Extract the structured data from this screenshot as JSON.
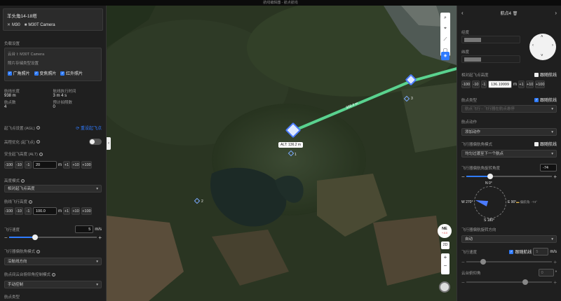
{
  "window_title": "航线编辑器 - 航点航线",
  "left": {
    "mission_name": "羊头角14-18塔",
    "drone": "M30",
    "camera": "M30T Camera",
    "payload_section": "负载设置",
    "payload_name": "云台 I: M30T Camera",
    "photo_storage_label": "照片存储类型设置",
    "photo_types": [
      "广角照片",
      "变焦照片",
      "红外照片"
    ],
    "stats": [
      {
        "label": "航线长度",
        "value": "938 m"
      },
      {
        "label": "航线执行时间",
        "value": "3 m 4 s"
      },
      {
        "label": "航点数",
        "value": "4"
      },
      {
        "label": "预计拍照数",
        "value": "0"
      }
    ],
    "takeoff_alt_label": "起飞点设置 (AGL)",
    "reset_takeoff": "重设起飞点",
    "elevation_opt_label": "高程优化 (起飞点)",
    "safe_alt_label": "安全起飞高度 (ALT)",
    "safe_alt_value": "20",
    "unit_m": "m",
    "step_buttons_neg": [
      "-100",
      "-10",
      "-1"
    ],
    "step_buttons_pos": [
      "+1",
      "+10",
      "+100"
    ],
    "alt_mode_label": "高度模式",
    "alt_mode_value": "相对起飞点高度",
    "route_alt_label": "航线飞行高度",
    "route_alt_value": "100.0",
    "speed_label": "飞行速度",
    "speed_value": "5",
    "speed_unit": "m/s",
    "speed_fraction": 0.3,
    "heading_mode_label": "飞行器偏航角模式",
    "heading_mode_value": "沿航线方向",
    "gimbal_mode_label": "航点间云台俯仰角控制模式",
    "gimbal_mode_value": "手动控制",
    "waypoint_type_label": "航点类型"
  },
  "map": {
    "segment_label": "368.4 m",
    "alt_label": "ALT: 136.2 m",
    "waypoint_labels": [
      "1",
      "2",
      "3"
    ],
    "compass_label": "NE",
    "compass_deg": "+.0.0",
    "mode_2d": "2D",
    "zoom_in": "+",
    "zoom_out": "−"
  },
  "right": {
    "header_title": "航点4",
    "lon_label": "经度",
    "lat_label": "纬度",
    "alt_label": "相对起飞点高度",
    "follow_route": "跟随航线",
    "alt_value": "136.19999",
    "speed_type_label": "航点类型",
    "speed_type_value": "航点飞行 - 飞行器在航点悬停",
    "action_label": "航点动作",
    "add_action": "添加动作",
    "yaw_mode_label": "飞行器偏航角模式",
    "yaw_mode_value": "均匀过渡至下一个航点",
    "yaw_angle_label": "飞行器偏航角旋转角度",
    "yaw_angle_value": "-74",
    "yaw_fraction": 0.28,
    "dial_n": "N 0°",
    "dial_e": "E 90°",
    "dial_s": "S 180°",
    "dial_w": "W 270°",
    "dial_note": "偏航角: -74°",
    "rotate_label": "飞行器偏航旋转方向",
    "rotate_value": "自动",
    "speed_label": "飞行速度",
    "speed_value": "5",
    "speed_unit": "m/s",
    "gimbal_pitch_label": "云台俯仰角",
    "gimbal_pitch_value": "0",
    "unit_deg": "°"
  }
}
